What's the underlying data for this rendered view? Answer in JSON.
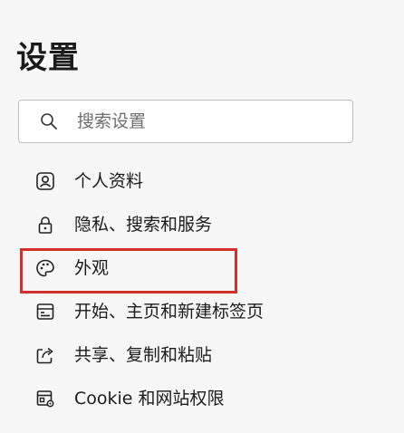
{
  "header": {
    "title": "设置"
  },
  "search": {
    "placeholder": "搜索设置",
    "icon": "search-icon"
  },
  "sidebar": {
    "items": [
      {
        "label": "个人资料",
        "icon": "profile-icon"
      },
      {
        "label": "隐私、搜索和服务",
        "icon": "lock-icon"
      },
      {
        "label": "外观",
        "icon": "palette-icon",
        "highlighted": true
      },
      {
        "label": "开始、主页和新建标签页",
        "icon": "home-tab-icon"
      },
      {
        "label": "共享、复制和粘贴",
        "icon": "share-icon"
      },
      {
        "label": "Cookie 和网站权限",
        "icon": "site-permissions-icon"
      }
    ]
  },
  "colors": {
    "highlight_border": "#d0312d",
    "background": "#f7f7f7"
  }
}
